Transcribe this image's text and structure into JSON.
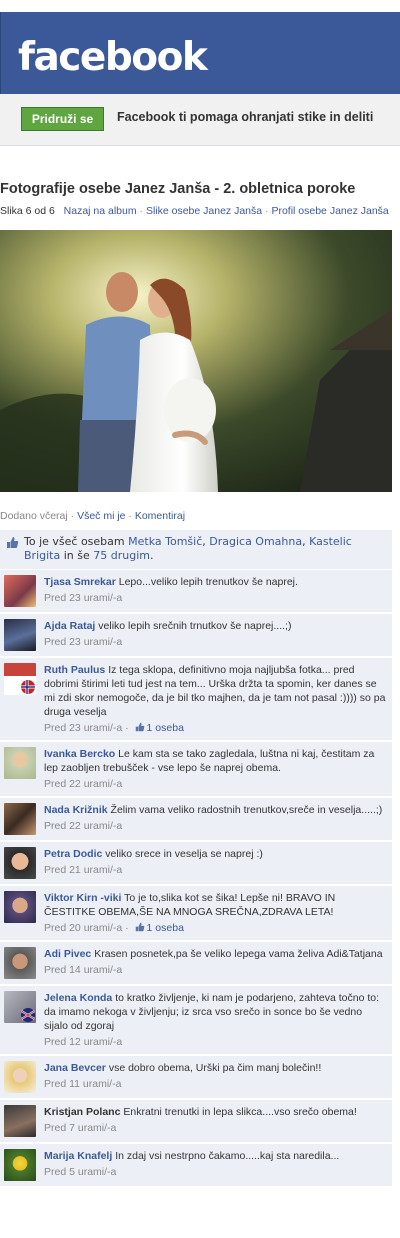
{
  "header": {
    "logo": "facebook"
  },
  "joinbar": {
    "button": "Pridruži se",
    "tagline": "Facebook ti pomaga ohranjati stike in deliti"
  },
  "album": {
    "title": "Fotografije osebe Janez Janša - 2. obletnica poroke",
    "counter": "Slika 6 od 6",
    "links": [
      "Nazaj na album",
      "Slike osebe Janez Janša",
      "Profil osebe Janez Janša"
    ],
    "separator": "·"
  },
  "actions": {
    "added": "Dodano včeraj",
    "like": "Všeč mi je",
    "comment": "Komentiraj",
    "separator": "·"
  },
  "likes": {
    "prefix": "To je všeč osebam",
    "people": [
      "Metka Tomšič",
      "Dragica Omahna",
      "Kastelic Brigita"
    ],
    "suffix": "in še",
    "others": "75 drugim",
    "end": "."
  },
  "comments": [
    {
      "name": "Tjasa Smrekar",
      "text": "Lepo...veliko lepih trenutkov še naprej.",
      "time": "Pred 23 urami/-a",
      "likes": ""
    },
    {
      "name": "Ajda Rataj",
      "text": "veliko lepih srečnih trnutkov še naprej....;)",
      "time": "Pred 23 urami/-a",
      "likes": ""
    },
    {
      "name": "Ruth Paulus",
      "text": "Iz tega sklopa, definitivno moja najljubša fotka... pred dobrimi štirimi leti tud jest na tem... Urška držta ta spomin, ker danes se mi zdi skor nemogoče, da je bil tko majhen, da je tam not pasal :)))) so pa druga veselja",
      "time": "Pred 23 urami/-a",
      "likes": "1 oseba"
    },
    {
      "name": "Ivanka Bercko",
      "text": "Le kam sta se tako zagledala, luštna ni kaj, čestitam za lep zaobljen trebušček - vse lepo še naprej obema.",
      "time": "Pred 22 urami/-a",
      "likes": ""
    },
    {
      "name": "Nada Križnik",
      "text": "Želim vama veliko radostnih trenutkov,sreče in veselja.....;)",
      "time": "Pred 22 urami/-a",
      "likes": ""
    },
    {
      "name": "Petra Dodic",
      "text": "veliko srece in veselja se naprej :)",
      "time": "Pred 21 urami/-a",
      "likes": ""
    },
    {
      "name": "Viktor Kirn -viki",
      "text": "To je to,slika kot se šika! Lepše ni! BRAVO IN ČESTITKE OBEMA,ŠE NA MNOGA SREČNA,ZDRAVA LETA!",
      "time": "Pred 20 urami/-a",
      "likes": "1 oseba"
    },
    {
      "name": "Adi Pivec",
      "text": "Krasen posnetek,pa še veliko lepega vama želiva Adi&Tatjana",
      "time": "Pred 14 urami/-a",
      "likes": ""
    },
    {
      "name": "Jelena Konda",
      "text": "to kratko življenje, ki nam je podarjeno, zahteva točno to: da imamo nekoga v življenju; iz srca vso srečo in sonce bo še vedno sijalo od zgoraj",
      "time": "Pred 12 urami/-a",
      "likes": ""
    },
    {
      "name": "Jana Bevcer",
      "text": "vse dobro obema, Urški pa čim manj bolečin!!",
      "time": "Pred 11 urami/-a",
      "likes": ""
    },
    {
      "name": "Kristjan Polanc",
      "text": "Enkratni trenutki in lepa slikca....vso srečo obema!",
      "time": "Pred 7 urami/-a",
      "likes": ""
    },
    {
      "name": "Marija Knafelj",
      "text": "In zdaj vsi nestrpno čakamo.....kaj sta naredila...",
      "time": "Pred 5 urami/-a",
      "likes": ""
    }
  ],
  "colors": {
    "brand": "#3b5998",
    "join": "#5fa640",
    "comment_bg": "#eceff5"
  },
  "icons": {
    "like": "thumbs-up-icon"
  }
}
